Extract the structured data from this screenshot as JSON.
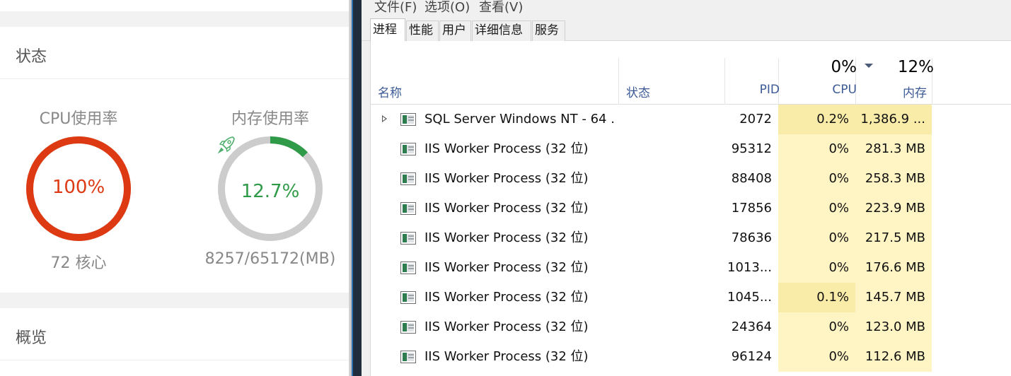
{
  "dashboard": {
    "status_title": "状态",
    "overview_title": "概览",
    "cpu": {
      "label": "CPU使用率",
      "value": "100%",
      "sub": "72 核心",
      "percent": 100,
      "color": "#dd3a14"
    },
    "memory": {
      "label": "内存使用率",
      "value": "12.7%",
      "sub": "8257/65172(MB)",
      "percent": 12.7,
      "color": "#2f9a47",
      "icon": "rocket-icon"
    }
  },
  "task_manager": {
    "menu": {
      "file": "文件(F)",
      "options": "选项(O)",
      "view": "查看(V)"
    },
    "tabs": {
      "processes": "进程",
      "performance": "性能",
      "users": "用户",
      "details": "详细信息",
      "services": "服务"
    },
    "active_tab": "进程",
    "header": {
      "name": "名称",
      "status": "状态",
      "pid": "PID",
      "cpu": "CPU",
      "cpu_total": "0%",
      "memory": "内存",
      "memory_total": "12%",
      "sort_column": "内存",
      "sort_direction": "descending"
    },
    "processes": [
      {
        "name": "SQL Server Windows NT - 64 ...",
        "pid": "2072",
        "cpu": "0.2%",
        "memory": "1,386.9 ...",
        "expandable": true,
        "cpu_highlight": true,
        "mem_highlight": true
      },
      {
        "name": "IIS Worker Process (32 位)",
        "pid": "95312",
        "cpu": "0%",
        "memory": "281.3 MB",
        "expandable": false
      },
      {
        "name": "IIS Worker Process (32 位)",
        "pid": "88408",
        "cpu": "0%",
        "memory": "258.3 MB",
        "expandable": false
      },
      {
        "name": "IIS Worker Process (32 位)",
        "pid": "17856",
        "cpu": "0%",
        "memory": "223.9 MB",
        "expandable": false
      },
      {
        "name": "IIS Worker Process (32 位)",
        "pid": "78636",
        "cpu": "0%",
        "memory": "217.5 MB",
        "expandable": false
      },
      {
        "name": "IIS Worker Process (32 位)",
        "pid": "1013...",
        "cpu": "0%",
        "memory": "176.6 MB",
        "expandable": false
      },
      {
        "name": "IIS Worker Process (32 位)",
        "pid": "1045...",
        "cpu": "0.1%",
        "memory": "145.7 MB",
        "expandable": false,
        "cpu_highlight": true
      },
      {
        "name": "IIS Worker Process (32 位)",
        "pid": "24364",
        "cpu": "0%",
        "memory": "123.0 MB",
        "expandable": false
      },
      {
        "name": "IIS Worker Process (32 位)",
        "pid": "96124",
        "cpu": "0%",
        "memory": "112.6 MB",
        "expandable": false
      }
    ]
  }
}
